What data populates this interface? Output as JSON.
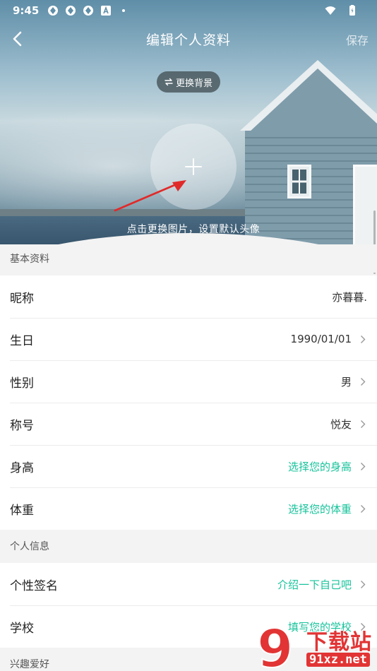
{
  "status_bar": {
    "time": "9:45"
  },
  "nav": {
    "title": "编辑个人资料",
    "save_label": "保存"
  },
  "hero": {
    "change_background_label": "更换背景",
    "hint": "点击更换图片，设置默认头像"
  },
  "sections": {
    "basic": {
      "title": "基本资料",
      "rows": [
        {
          "label": "昵称",
          "value": "亦暮暮.",
          "accent": false,
          "chevron": false
        },
        {
          "label": "生日",
          "value": "1990/01/01",
          "accent": false,
          "chevron": true
        },
        {
          "label": "性别",
          "value": "男",
          "accent": false,
          "chevron": true
        },
        {
          "label": "称号",
          "value": "悦友",
          "accent": false,
          "chevron": true
        },
        {
          "label": "身高",
          "value": "选择您的身高",
          "accent": true,
          "chevron": true
        },
        {
          "label": "体重",
          "value": "选择您的体重",
          "accent": true,
          "chevron": true
        }
      ]
    },
    "personal": {
      "title": "个人信息",
      "rows": [
        {
          "label": "个性签名",
          "value": "介绍一下自己吧",
          "accent": true,
          "chevron": true
        },
        {
          "label": "学校",
          "value": "填写您的学校",
          "accent": true,
          "chevron": true
        }
      ]
    },
    "hobbies": {
      "title": "兴趣爱好"
    }
  },
  "watermark": {
    "digit": "9",
    "text": "下载站",
    "url": "91xz.net"
  },
  "colors": {
    "accent": "#17c39b",
    "arrow": "#e02a2a",
    "watermark": "#e23434"
  }
}
